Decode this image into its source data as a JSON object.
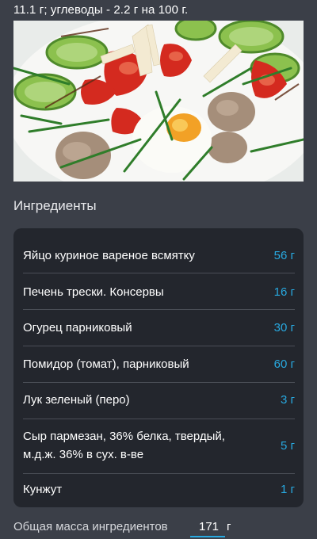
{
  "header": {
    "nutrition_text": "11.1 г; углеводы - 2.2 г на 100 г."
  },
  "section": {
    "title": "Ингредиенты"
  },
  "ingredients": [
    {
      "name": "Яйцо куриное вареное всмятку",
      "amount": "56 г"
    },
    {
      "name": "Печень трески. Консервы",
      "amount": "16 г"
    },
    {
      "name": "Огурец парниковый",
      "amount": "30 г"
    },
    {
      "name": "Помидор (томат), парниковый",
      "amount": "60 г"
    },
    {
      "name": "Лук зеленый (перо)",
      "amount": "3 г"
    },
    {
      "name": "Сыр пармезан, 36% белка, твердый, м.д.ж. 36% в сух. в-ве",
      "amount": "5 г"
    },
    {
      "name": "Кунжут",
      "amount": "1 г"
    }
  ],
  "total": {
    "label": "Общая масса ингредиентов",
    "value": "171",
    "unit": "г"
  },
  "colors": {
    "background": "#3b3f48",
    "card": "#23262d",
    "accent": "#28a9e0"
  }
}
